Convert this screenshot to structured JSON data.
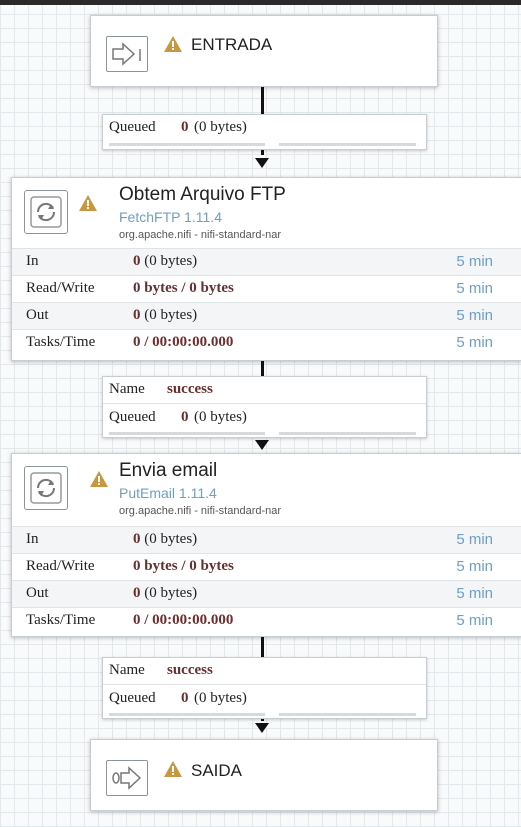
{
  "ports": {
    "input": {
      "name": "ENTRADA",
      "icon": "input-port-icon"
    },
    "output": {
      "name": "SAIDA",
      "icon": "output-port-icon"
    }
  },
  "connections": [
    {
      "name_label": "",
      "name": "",
      "queued_label": "Queued",
      "queued_count": "0",
      "queued_bytes": "(0 bytes)"
    },
    {
      "name_label": "Name",
      "name": "success",
      "queued_label": "Queued",
      "queued_count": "0",
      "queued_bytes": "(0 bytes)"
    },
    {
      "name_label": "Name",
      "name": "success",
      "queued_label": "Queued",
      "queued_count": "0",
      "queued_bytes": "(0 bytes)"
    }
  ],
  "processors": [
    {
      "name": "Obtem Arquivo FTP",
      "type": "FetchFTP 1.11.4",
      "bundle": "org.apache.nifi - nifi-standard-nar",
      "stats": [
        {
          "label": "In",
          "count": "0",
          "extra": "(0 bytes)",
          "time": "5 min"
        },
        {
          "label": "Read/Write",
          "count": "0 bytes / 0 bytes",
          "extra": "",
          "time": "5 min"
        },
        {
          "label": "Out",
          "count": "0",
          "extra": "(0 bytes)",
          "time": "5 min"
        },
        {
          "label": "Tasks/Time",
          "count": "0 / 00:00:00.000",
          "extra": "",
          "time": "5 min"
        }
      ]
    },
    {
      "name": "Envia email",
      "type": "PutEmail 1.11.4",
      "bundle": "org.apache.nifi - nifi-standard-nar",
      "stats": [
        {
          "label": "In",
          "count": "0",
          "extra": "(0 bytes)",
          "time": "5 min"
        },
        {
          "label": "Read/Write",
          "count": "0 bytes / 0 bytes",
          "extra": "",
          "time": "5 min"
        },
        {
          "label": "Out",
          "count": "0",
          "extra": "(0 bytes)",
          "time": "5 min"
        },
        {
          "label": "Tasks/Time",
          "count": "0 / 00:00:00.000",
          "extra": "",
          "time": "5 min"
        }
      ]
    }
  ],
  "colors": {
    "warning": "#c9973f",
    "link": "#6e9fc4",
    "value": "#6b2e2e"
  }
}
